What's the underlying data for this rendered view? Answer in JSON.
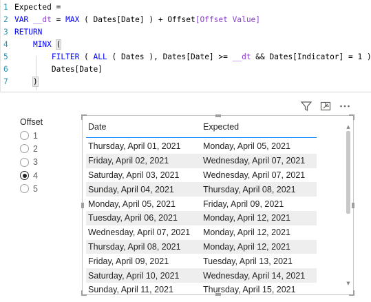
{
  "editor": {
    "lines": [
      {
        "n": "1",
        "parts": [
          {
            "t": "Expected = ",
            "c": "dim"
          }
        ]
      },
      {
        "n": "2",
        "parts": [
          {
            "t": "VAR ",
            "c": "kw"
          },
          {
            "t": "__dt",
            "c": "col"
          },
          {
            "t": " = ",
            "c": "dim"
          },
          {
            "t": "MAX",
            "c": "kw"
          },
          {
            "t": " ( Dates[Date] ) + Offset",
            "c": "dim"
          },
          {
            "t": "[Offset Value]",
            "c": "col"
          }
        ]
      },
      {
        "n": "3",
        "parts": [
          {
            "t": "RETURN",
            "c": "kw"
          }
        ]
      },
      {
        "n": "4",
        "parts": [
          {
            "t": "    ",
            "c": "dim"
          },
          {
            "t": "MINX",
            "c": "kw"
          },
          {
            "t": " ",
            "c": "dim"
          },
          {
            "t": "(",
            "c": "bracket"
          }
        ]
      },
      {
        "n": "5",
        "parts": [
          {
            "t": "        ",
            "c": "dim"
          },
          {
            "t": "FILTER",
            "c": "kw"
          },
          {
            "t": " ( ",
            "c": "dim"
          },
          {
            "t": "ALL",
            "c": "kw"
          },
          {
            "t": " ( Dates ), Dates[Date] >= ",
            "c": "dim"
          },
          {
            "t": "__dt",
            "c": "col"
          },
          {
            "t": " && Dates[Indicator] = 1 ),",
            "c": "dim"
          }
        ]
      },
      {
        "n": "6",
        "parts": [
          {
            "t": "        Dates[Date]",
            "c": "dim"
          }
        ]
      },
      {
        "n": "7",
        "parts": [
          {
            "t": "    ",
            "c": "dim"
          },
          {
            "t": ")",
            "c": "bracket"
          }
        ]
      }
    ]
  },
  "visual_header": {
    "icons": [
      "filter-icon",
      "focus-mode-icon",
      "more-options-icon"
    ]
  },
  "slicer": {
    "title": "Offset",
    "options": [
      {
        "label": "1",
        "checked": false
      },
      {
        "label": "2",
        "checked": false
      },
      {
        "label": "3",
        "checked": false
      },
      {
        "label": "4",
        "checked": true
      },
      {
        "label": "5",
        "checked": false
      }
    ]
  },
  "table": {
    "headers": [
      "Date",
      "Expected"
    ],
    "rows": [
      [
        "Thursday, April 01, 2021",
        "Monday, April 05, 2021"
      ],
      [
        "Friday, April 02, 2021",
        "Wednesday, April 07, 2021"
      ],
      [
        "Saturday, April 03, 2021",
        "Wednesday, April 07, 2021"
      ],
      [
        "Sunday, April 04, 2021",
        "Thursday, April 08, 2021"
      ],
      [
        "Monday, April 05, 2021",
        "Friday, April 09, 2021"
      ],
      [
        "Tuesday, April 06, 2021",
        "Monday, April 12, 2021"
      ],
      [
        "Wednesday, April 07, 2021",
        "Monday, April 12, 2021"
      ],
      [
        "Thursday, April 08, 2021",
        "Monday, April 12, 2021"
      ],
      [
        "Friday, April 09, 2021",
        "Tuesday, April 13, 2021"
      ],
      [
        "Saturday, April 10, 2021",
        "Wednesday, April 14, 2021"
      ],
      [
        "Sunday, April 11, 2021",
        "Thursday, April 15, 2021"
      ]
    ],
    "accent_color": "#118dff"
  }
}
